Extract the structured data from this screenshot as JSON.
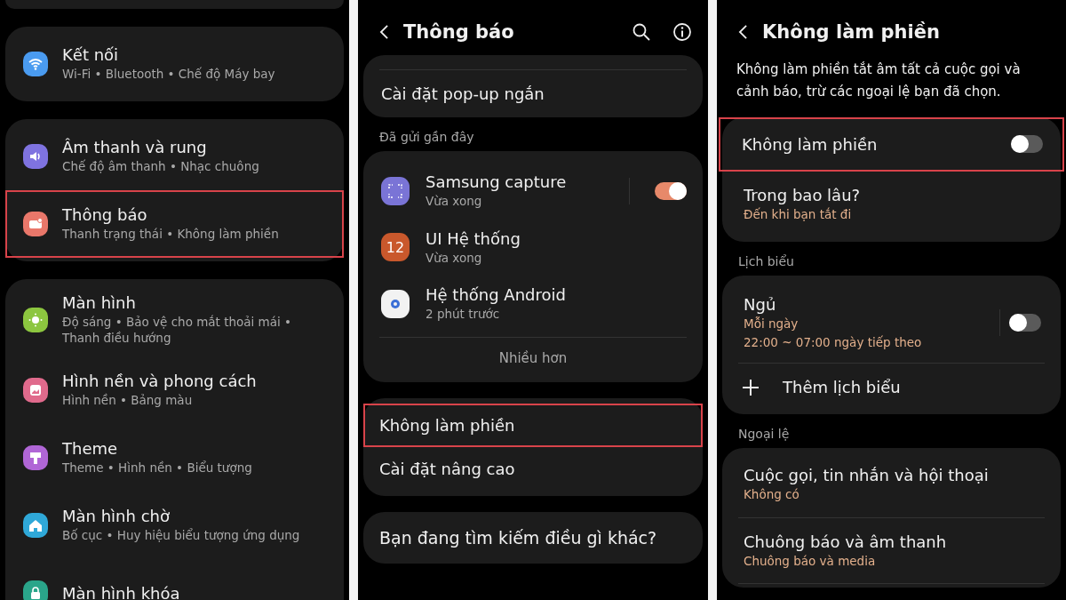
{
  "settings_menu": {
    "groups": [
      {
        "items": [
          {
            "title": "Kết nối",
            "subtitle": "Wi-Fi • Bluetooth • Chế độ Máy bay",
            "color": "#4a9bf0",
            "highlighted": false
          }
        ]
      },
      {
        "items": [
          {
            "title": "Âm thanh và rung",
            "subtitle": "Chế độ âm thanh • Nhạc chuông",
            "color": "#7f73e0",
            "highlighted": false
          },
          {
            "title": "Thông báo",
            "subtitle": "Thanh trạng thái • Không làm phiền",
            "color": "#e9776a",
            "highlighted": true
          }
        ]
      },
      {
        "items": [
          {
            "title": "Màn hình",
            "subtitle": "Độ sáng • Bảo vệ cho mắt thoải mái • Thanh điều hướng",
            "color": "#8cc63f",
            "highlighted": false
          },
          {
            "title": "Hình nền và phong cách",
            "subtitle": "Hình nền • Bảng màu",
            "color": "#e06a8c",
            "highlighted": false
          },
          {
            "title": "Theme",
            "subtitle": "Theme • Hình nền • Biểu tượng",
            "color": "#b066d6",
            "highlighted": false
          },
          {
            "title": "Màn hình chờ",
            "subtitle": "Bố cục • Huy hiệu biểu tượng ứng dụng",
            "color": "#2fa8d8",
            "highlighted": false
          },
          {
            "title": "Màn hình khóa",
            "color": "#2aa58a",
            "highlighted": false
          }
        ]
      }
    ]
  },
  "notifications_screen": {
    "header": {
      "title": "Thông báo"
    },
    "top_items": [
      {
        "title": "Cài đặt pop-up ngắn"
      }
    ],
    "recent_label": "Đã gửi gần đây",
    "recent_apps": [
      {
        "kind": "toggle",
        "name": "Samsung capture",
        "time": "Vừa xong",
        "color": "#7a74d6",
        "on": true
      },
      {
        "kind": "plain",
        "name": "UI Hệ thống",
        "time": "Vừa xong",
        "color": "#c9582c",
        "icon_text": "12"
      },
      {
        "kind": "plain",
        "name": "Hệ thống Android",
        "time": "2 phút trước",
        "color": "#f2f2f2"
      }
    ],
    "more": "Nhiều hơn",
    "settings": [
      {
        "title": "Không làm phiền",
        "highlighted": true
      },
      {
        "title": "Cài đặt nâng cao",
        "highlighted": false
      }
    ],
    "search_prompt": "Bạn đang tìm kiếm điều gì khác?"
  },
  "do_not_disturb_screen": {
    "header": {
      "title": "Không làm phiền"
    },
    "description": "Không làm phiền tắt âm tất cả cuộc gọi và cảnh báo, trừ các ngoại lệ bạn đã chọn.",
    "main": [
      {
        "kind": "toggle",
        "title": "Không làm phiền",
        "on": false,
        "highlighted": true
      },
      {
        "kind": "plain",
        "title": "Trong bao lâu?",
        "subtitle": "Đến khi bạn tắt đi",
        "highlighted": false
      }
    ],
    "schedule_label": "Lịch biểu",
    "schedules": [
      {
        "title": "Ngủ",
        "lines": [
          "Mỗi ngày",
          "22:00 ~ 07:00 ngày tiếp theo"
        ],
        "on": false
      }
    ],
    "add_schedule": "Thêm lịch biểu",
    "exceptions_label": "Ngoại lệ",
    "exceptions": [
      {
        "title": "Cuộc gọi, tin nhắn và hội thoại",
        "subtitle": "Không có"
      },
      {
        "title": "Chuông báo và âm thanh",
        "subtitle": "Chuông báo và media"
      }
    ]
  }
}
